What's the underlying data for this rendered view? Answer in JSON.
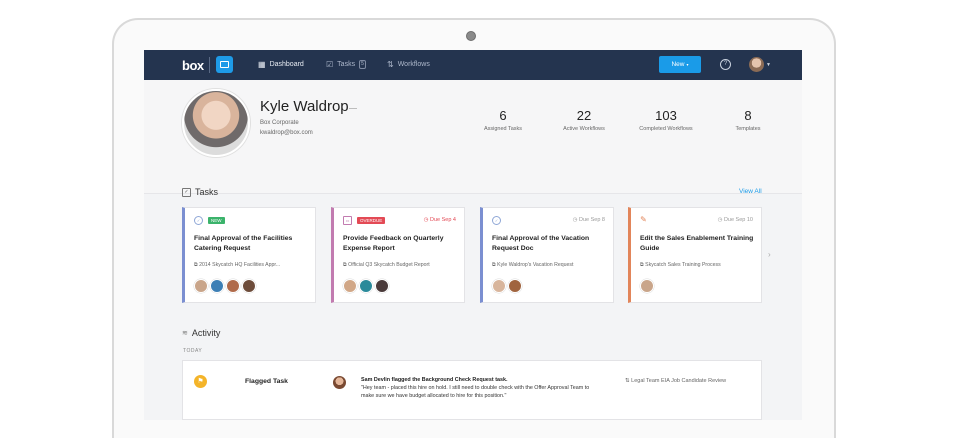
{
  "nav": {
    "logo": "box",
    "items": [
      {
        "label": "Dashboard",
        "icon": "grid-icon",
        "active": true
      },
      {
        "label": "Tasks",
        "icon": "checkbox-icon",
        "badge": "5"
      },
      {
        "label": "Workflows",
        "icon": "workflow-icon"
      }
    ],
    "new_label": "New",
    "help_glyph": "?"
  },
  "profile": {
    "name": "Kyle Waldrop",
    "company": "Box Corporate",
    "email": "kwaldrop@box.com",
    "stats": [
      {
        "num": "6",
        "label": "Assigned Tasks"
      },
      {
        "num": "22",
        "label": "Active Workflows"
      },
      {
        "num": "103",
        "label": "Completed Workflows"
      },
      {
        "num": "8",
        "label": "Templates"
      }
    ]
  },
  "tasks": {
    "title": "Tasks",
    "view_all": "View All",
    "cards": [
      {
        "accent": "#7b8fd1",
        "badge": "NEW",
        "badge_color": "#3bb36b",
        "due": "",
        "title": "Final Approval of the Facilities Catering Request",
        "file": "2014 Skycatch HQ Facilities Appr...",
        "avatars": [
          "#c9a58a",
          "#3d7fb5",
          "#b06a4a",
          "#6d4c3a"
        ]
      },
      {
        "accent": "#c27bb0",
        "badge": "OVERDUE",
        "badge_color": "#e34a55",
        "due": "Due Sep 4",
        "due_red": true,
        "title": "Provide Feedback on Quarterly Expense Report",
        "file": "Official Q3 Skycatch Budget Report",
        "avatars": [
          "#d1a787",
          "#2a8a9a",
          "#4a3a3a"
        ]
      },
      {
        "accent": "#7b8fd1",
        "badge": "",
        "due": "Due Sep 8",
        "title": "Final Approval of the Vacation Request Doc",
        "file": "Kyle Waldrop's Vacation Request",
        "avatars": [
          "#d8b59c",
          "#a0643f"
        ]
      },
      {
        "accent": "#e2855a",
        "badge": "",
        "due": "Due Sep 10",
        "title": "Edit the Sales Enablement Training Guide",
        "file": "Skycatch Sales Training Process",
        "avatars": [
          "#c9a58a"
        ]
      }
    ]
  },
  "activity": {
    "title": "Activity",
    "today": "TODAY",
    "row": {
      "title": "Flagged Task",
      "actor": "Sam Devlin flagged the Background Check Request task.",
      "message": "\"Hey team - placed this hire on hold. I still need to double check with the Offer Approval Team to make sure we have budget allocated to hire for this position.\"",
      "link": "Legal Team EIA Job Candidate Review"
    }
  }
}
